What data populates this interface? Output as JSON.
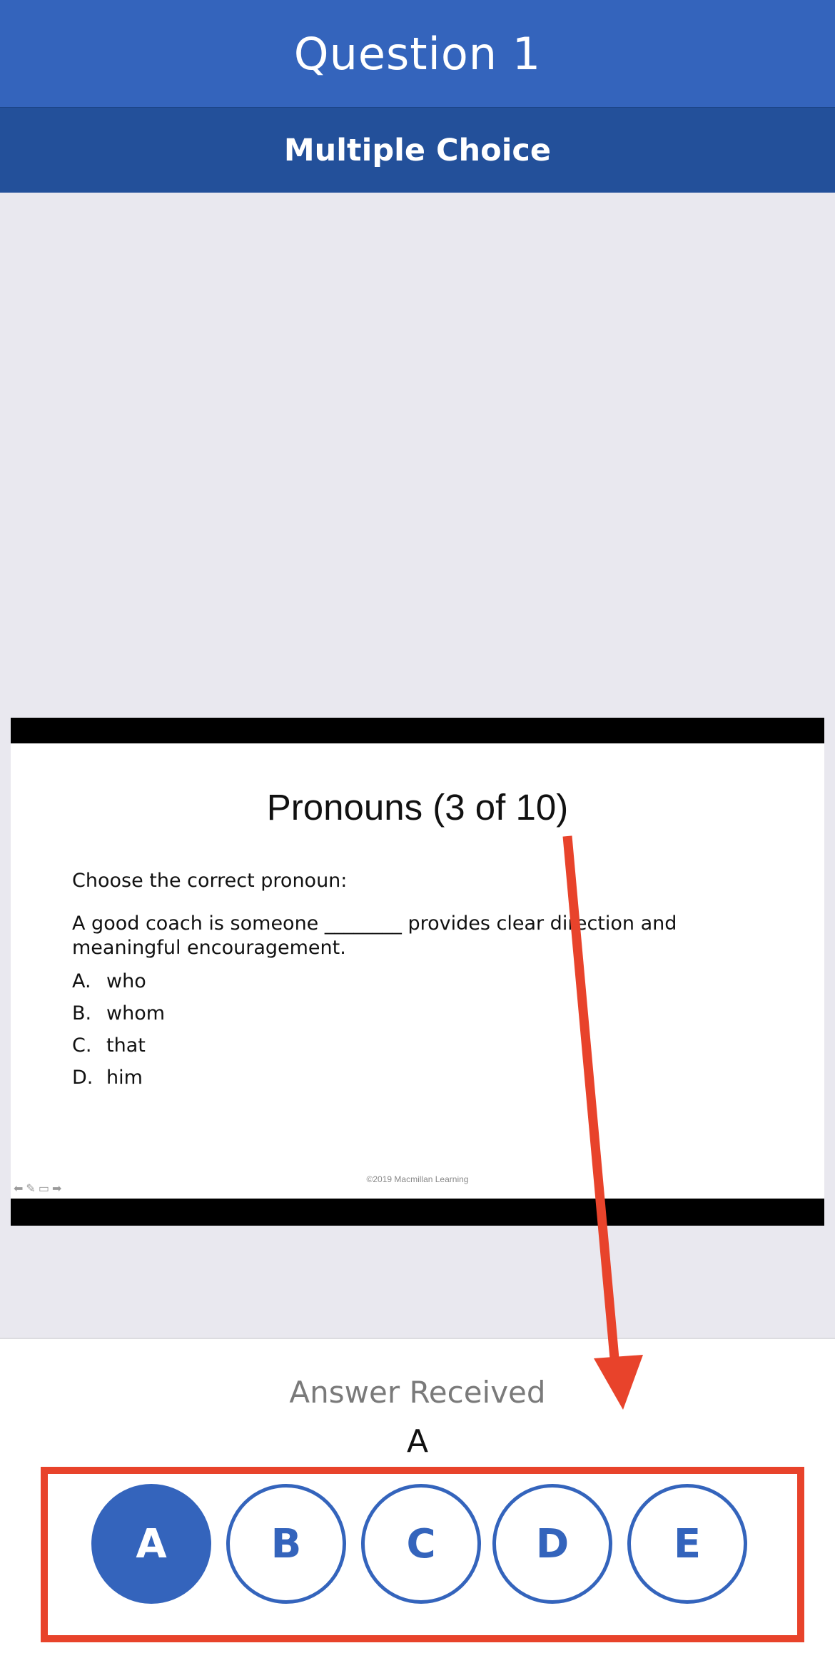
{
  "header": {
    "title": "Question 1",
    "subtitle": "Multiple Choice"
  },
  "slide": {
    "title": "Pronouns (3 of 10)",
    "prompt": "Choose the correct pronoun:",
    "question": "A good coach is someone ________ provides clear direction and meaningful encouragement.",
    "choices": [
      {
        "letter": "A.",
        "text": "who"
      },
      {
        "letter": "B.",
        "text": "whom"
      },
      {
        "letter": "C.",
        "text": "that"
      },
      {
        "letter": "D.",
        "text": "him"
      }
    ],
    "copyright": "©2019 Macmillan Learning",
    "tool_icons": [
      "arrow-left-icon",
      "pen-icon",
      "screen-icon",
      "arrow-right-icon"
    ]
  },
  "answer": {
    "label": "Answer Received",
    "value": "A"
  },
  "options": [
    {
      "label": "A",
      "selected": true
    },
    {
      "label": "B",
      "selected": false
    },
    {
      "label": "C",
      "selected": false
    },
    {
      "label": "D",
      "selected": false
    },
    {
      "label": "E",
      "selected": false
    }
  ],
  "colors": {
    "header": "#3464bc",
    "subheader": "#23509a",
    "background": "#e9e8ef",
    "annotation": "#e8432b"
  }
}
